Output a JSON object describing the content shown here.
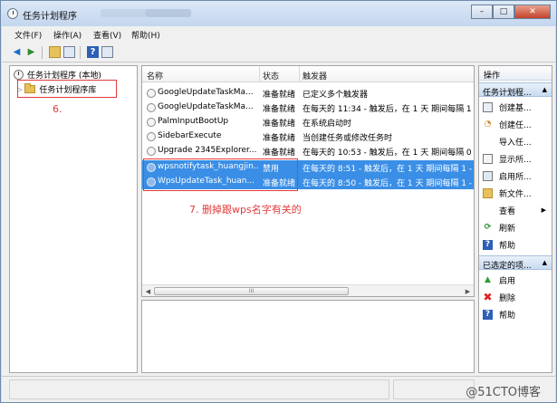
{
  "window": {
    "title": "任务计划程序",
    "controls": {
      "minimize": "–",
      "maximize": "□",
      "close": "✕"
    }
  },
  "menu": [
    "文件(F)",
    "操作(A)",
    "查看(V)",
    "帮助(H)"
  ],
  "toolbar": {
    "icons": [
      "back-arrow",
      "forward-arrow",
      "up-folder",
      "show-hide-tree",
      "help",
      "show-hide-action-pane"
    ]
  },
  "tree": {
    "root_label": "任务计划程序 (本地)",
    "library_label": "任务计划程序库"
  },
  "annotations": {
    "step6": "6.",
    "step7": "7. 删掉跟wps名字有关的"
  },
  "task_list": {
    "columns": [
      "名称",
      "状态",
      "触发器"
    ],
    "rows": [
      {
        "name": "GoogleUpdateTaskMa...",
        "status": "准备就绪",
        "trigger": "已定义多个触发器",
        "selected": false
      },
      {
        "name": "GoogleUpdateTaskMa...",
        "status": "准备就绪",
        "trigger": "在每天的 11:34 - 触发后，在 1 天 期间每隔 1",
        "selected": false
      },
      {
        "name": "PalmInputBootUp",
        "status": "准备就绪",
        "trigger": "在系统启动时",
        "selected": false
      },
      {
        "name": "SidebarExecute",
        "status": "准备就绪",
        "trigger": "当创建任务或修改任务时",
        "selected": false
      },
      {
        "name": "Upgrade 2345Explorer...",
        "status": "准备就绪",
        "trigger": "在每天的 10:53 - 触发后，在 1 天 期间每隔 0",
        "selected": false
      },
      {
        "name": "wpsnotifytask_huangjin...",
        "status": "禁用",
        "trigger": "在每天的 8:51 - 触发后，在 1 天 期间每隔 1 -",
        "selected": true
      },
      {
        "name": "WpsUpdateTask_huan...",
        "status": "准备就绪",
        "trigger": "在每天的 8:50 - 触发后，在 1 天 期间每隔 1 -",
        "selected": true
      }
    ],
    "scroll_thumb_glyph": "III"
  },
  "actions_pane": {
    "title": "操作",
    "section1": {
      "label": "任务计划程...",
      "items": [
        {
          "label": "创建基...",
          "icon": "create-basic-task-icon"
        },
        {
          "label": "创建任...",
          "icon": "create-task-icon"
        },
        {
          "label": "导入任...",
          "icon": "import-task-icon"
        },
        {
          "label": "显示所...",
          "icon": "display-running-tasks-icon"
        },
        {
          "label": "启用所...",
          "icon": "enable-history-icon"
        },
        {
          "label": "新文件...",
          "icon": "new-folder-icon"
        },
        {
          "label": "查看",
          "icon": "view-icon"
        },
        {
          "label": "刷新",
          "icon": "refresh-icon"
        },
        {
          "label": "帮助",
          "icon": "help-icon"
        }
      ]
    },
    "section2": {
      "label": "已选定的项...",
      "items": [
        {
          "label": "启用",
          "icon": "enable-icon"
        },
        {
          "label": "删除",
          "icon": "delete-icon"
        },
        {
          "label": "帮助",
          "icon": "help-icon"
        }
      ]
    }
  },
  "watermark": "@51CTO博客",
  "colors": {
    "selection": "#3a8ee6",
    "annotation_red": "#e23a3a"
  }
}
